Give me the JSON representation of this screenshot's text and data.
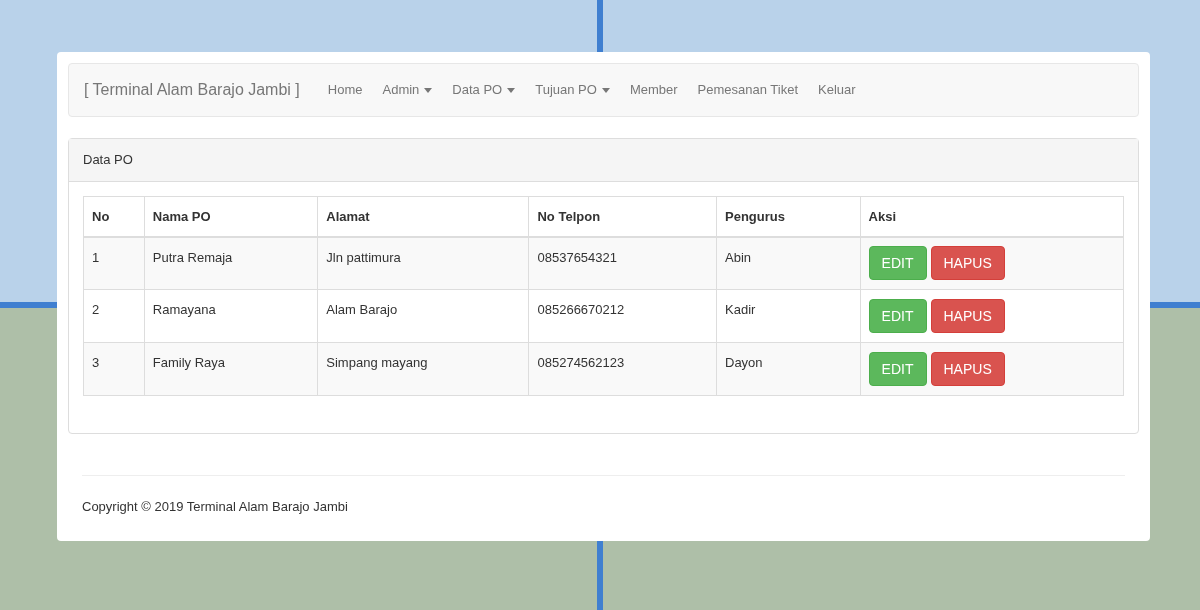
{
  "navbar": {
    "brand": "[ Terminal Alam Barajo Jambi ]",
    "items": [
      {
        "label": "Home",
        "dropdown": false
      },
      {
        "label": "Admin",
        "dropdown": true
      },
      {
        "label": "Data PO",
        "dropdown": true
      },
      {
        "label": "Tujuan PO",
        "dropdown": true
      },
      {
        "label": "Member",
        "dropdown": false
      },
      {
        "label": "Pemesanan Tiket",
        "dropdown": false
      },
      {
        "label": "Keluar",
        "dropdown": false
      }
    ]
  },
  "panel": {
    "title": "Data PO",
    "table": {
      "columns": [
        "No",
        "Nama PO",
        "Alamat",
        "No Telpon",
        "Pengurus",
        "Aksi"
      ],
      "rows": [
        {
          "cells": [
            "1",
            "Putra Remaja",
            "Jln pattimura",
            "08537654321",
            "Abin"
          ],
          "actions": [
            {
              "label": "EDIT",
              "kind": "edit"
            },
            {
              "label": "HAPUS",
              "kind": "delete"
            }
          ]
        },
        {
          "cells": [
            "2",
            "Ramayana",
            "Alam Barajo",
            "085266670212",
            "Kadir"
          ],
          "actions": [
            {
              "label": "EDIT",
              "kind": "edit"
            },
            {
              "label": "HAPUS",
              "kind": "delete"
            }
          ]
        },
        {
          "cells": [
            "3",
            "Family Raya",
            "Simpang mayang",
            "085274562123",
            "Dayon"
          ],
          "actions": [
            {
              "label": "EDIT",
              "kind": "edit"
            },
            {
              "label": "HAPUS",
              "kind": "delete"
            }
          ]
        }
      ]
    }
  },
  "footer": {
    "copyright": "Copyright © 2019 Terminal Alam Barajo Jambi"
  }
}
